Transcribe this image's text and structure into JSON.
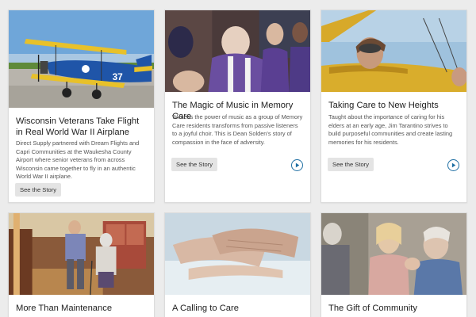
{
  "cards": [
    {
      "title": "Wisconsin Veterans Take Flight in Real World War II Airplane",
      "body": "Direct Supply partnered with Dream Flights and Capri Communities at the Waukesha County Airport where senior veterans from across Wisconsin came together to fly in an authentic World War II airplane.",
      "button": "See the Story",
      "plane_number": "37",
      "image": "biplane-on-runway"
    },
    {
      "title": "The Magic of Music in Memory Care",
      "body": "Witness the power of music as a group of Memory Care residents transforms from passive listeners to a joyful choir. This is Dean Solden's story of compassion in the face of adversity.",
      "button": "See the Story",
      "has_video": true,
      "image": "choir-singing"
    },
    {
      "title": "Taking Care to New Heights",
      "body": "Taught about the importance of caring for his elders at an early age, Jim Tarantino strives to build purposeful communities and create lasting memories for his residents.",
      "button": "See the Story",
      "has_video": true,
      "image": "pilot-in-cockpit"
    },
    {
      "title": "More Than Maintenance",
      "image": "couple-walking-hallway"
    },
    {
      "title": "A Calling to Care",
      "image": "hands-holding"
    },
    {
      "title": "The Gift of Community",
      "image": "women-laughing"
    }
  ],
  "colors": {
    "accent": "#1e6fa3",
    "button_bg": "#e4e4e4",
    "page_bg": "#ececec"
  },
  "icons": {
    "play": "play-circle-icon"
  }
}
